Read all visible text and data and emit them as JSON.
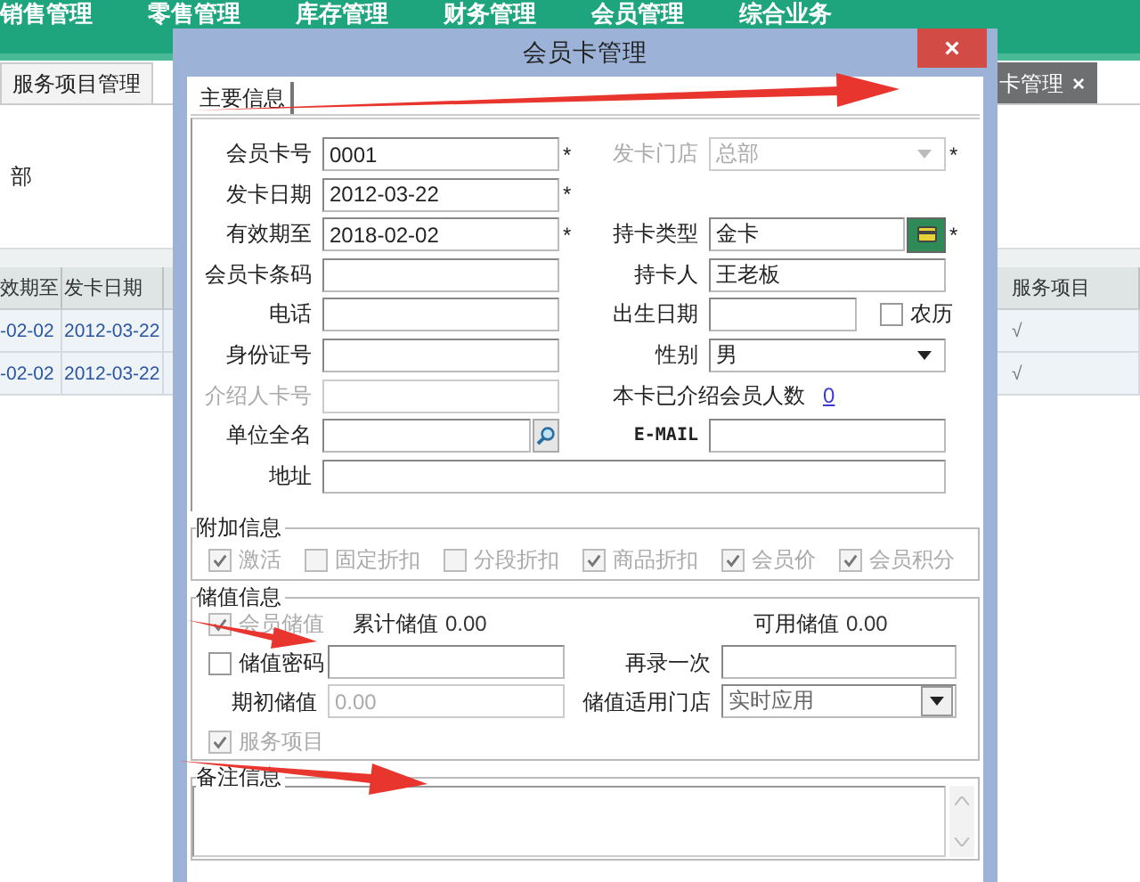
{
  "menu_bar": [
    "销售管理",
    "零售管理",
    "库存管理",
    "财务管理",
    "会员管理",
    "综合业务"
  ],
  "tabs": [
    {
      "label": "服务项目管理",
      "selected": false
    },
    {
      "label": "卡管理",
      "selected": true,
      "close": "×"
    }
  ],
  "side_text": "部",
  "table": {
    "columns": [
      "效期至",
      "发卡日期"
    ],
    "rows": [
      [
        "-02-02",
        "2012-03-22"
      ],
      [
        "-02-02",
        "2012-03-22"
      ]
    ]
  },
  "table_right": {
    "columns": [
      "服务项目"
    ],
    "rows": [
      [
        "√"
      ],
      [
        "√"
      ]
    ]
  },
  "dialog": {
    "title": "会员卡管理",
    "close": "×",
    "tabs": [
      {
        "label": "主要信息",
        "selected": true
      }
    ],
    "rows": [
      {
        "left": {
          "label": "会员卡号",
          "kind": "text",
          "value": "0001",
          "suffix": "*"
        },
        "right": {
          "label": "发卡门店",
          "kind": "select",
          "value": "总部",
          "disabled": true,
          "suffix": "*"
        }
      },
      {
        "left": {
          "label": "发卡日期",
          "kind": "text",
          "value": "2012-03-22",
          "suffix": "*"
        }
      },
      {
        "left": {
          "label": "有效期至",
          "kind": "text",
          "value": "2018-02-02",
          "suffix": "*"
        },
        "right": {
          "label": "持卡类型",
          "kind": "card_lookup",
          "value": "金卡",
          "suffix": "*"
        }
      },
      {
        "left": {
          "label": "会员卡条码",
          "kind": "text"
        },
        "right": {
          "label": "持卡人",
          "kind": "text",
          "value": "王老板"
        }
      },
      {
        "left": {
          "label": "电话",
          "kind": "text"
        },
        "right": {
          "label": "出生日期",
          "kind": "date_check",
          "check": {
            "label": "农历",
            "checked": false
          }
        }
      },
      {
        "left": {
          "label": "身份证号",
          "kind": "text"
        },
        "right": {
          "label": "性别",
          "kind": "select",
          "value": "男"
        }
      },
      {
        "left": {
          "label": "介绍人卡号",
          "kind": "text",
          "disabled": true
        },
        "right": {
          "label": "本卡已介绍会员人数",
          "kind": "link_count",
          "link": "0"
        }
      },
      {
        "left": {
          "label": "单位全名",
          "kind": "search_lookup"
        },
        "right": {
          "label": "E-MAIL",
          "kind": "email"
        }
      },
      {
        "left": {
          "label": "地址",
          "kind": "wide"
        }
      }
    ],
    "extra": {
      "title": "附加信息",
      "options": [
        {
          "label": "激活",
          "checked": true,
          "disabled": true
        },
        {
          "label": "固定折扣",
          "checked": false,
          "disabled": true
        },
        {
          "label": "分段折扣",
          "checked": false,
          "disabled": true
        },
        {
          "label": "商品折扣",
          "checked": true,
          "disabled": true
        },
        {
          "label": "会员价",
          "checked": true,
          "disabled": true
        },
        {
          "label": "会员积分",
          "checked": true,
          "disabled": true
        }
      ]
    },
    "stored": {
      "title": "储值信息",
      "member_stored": {
        "label": "会员储值",
        "checked": true,
        "disabled": true
      },
      "total": {
        "label": "累计储值",
        "value": "0.00"
      },
      "available": {
        "label": "可用储值",
        "value": "0.00"
      },
      "password": {
        "label": "储值密码",
        "checked": false,
        "disabled": false
      },
      "repeat": {
        "label": "再录一次"
      },
      "opening": {
        "label": "期初储值",
        "value": "0.00",
        "disabled": true
      },
      "store": {
        "label": "储值适用门店",
        "value": "实时应用"
      },
      "service": {
        "label": "服务项目",
        "checked": true,
        "disabled": true
      }
    },
    "remarks": {
      "title": "备注信息"
    }
  },
  "annotation_arrows": [
    {
      "kind": "arrow"
    },
    {
      "kind": "arrow"
    },
    {
      "kind": "arrow"
    }
  ]
}
